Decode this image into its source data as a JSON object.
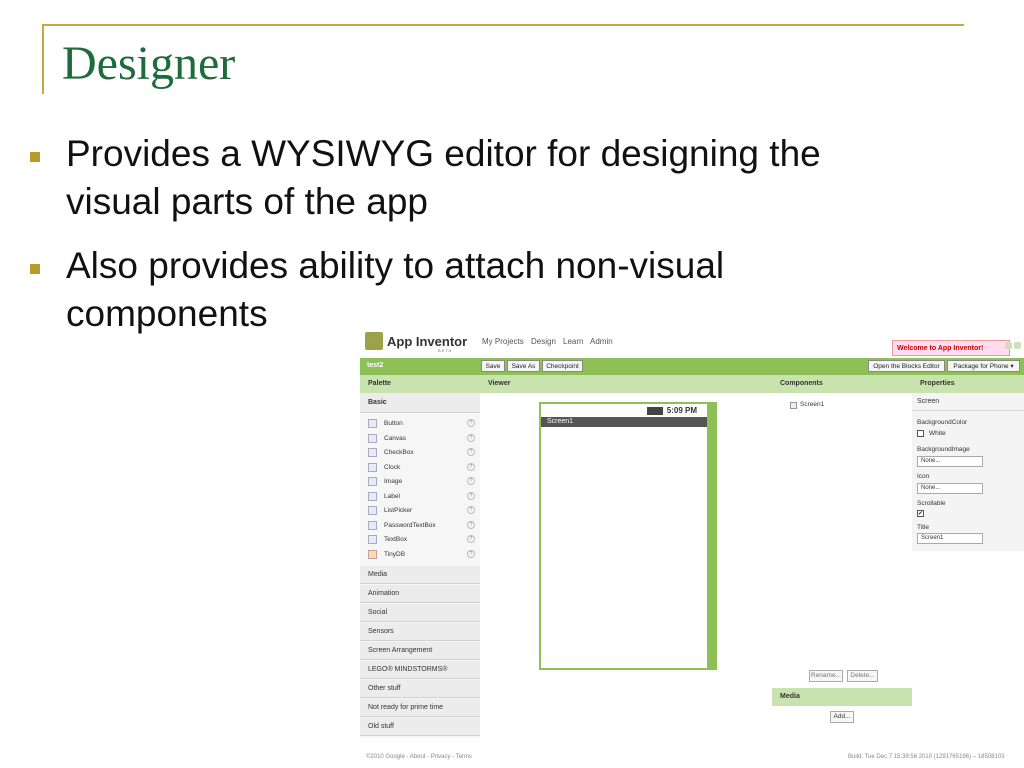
{
  "slide": {
    "title": "Designer",
    "bullets": [
      {
        "line1": "Provides a WYSIWYG editor for designing the",
        "line2": "visual parts of the app"
      },
      {
        "line1": "Also provides ability to attach non-visual",
        "line2": "components"
      }
    ]
  },
  "app": {
    "logo_text": "App Inventor",
    "logo_beta": "BETA",
    "nav": [
      "My Projects",
      "Design",
      "Learn",
      "Admin"
    ],
    "welcome": "Welcome to App Inventor!",
    "project_name": "test2",
    "toolbar": {
      "save": "Save",
      "save_as": "Save As",
      "checkpoint": "Checkpoint",
      "blocks_editor": "Open the Blocks Editor",
      "package": "Package for Phone ▾"
    },
    "columns": {
      "palette": "Palette",
      "viewer": "Viewer",
      "components": "Components",
      "properties": "Properties"
    },
    "palette": {
      "basic": "Basic",
      "items": [
        "Button",
        "Canvas",
        "CheckBox",
        "Clock",
        "Image",
        "Label",
        "ListPicker",
        "PasswordTextBox",
        "TextBox",
        "TinyDB"
      ],
      "help": "?",
      "categories": [
        "Media",
        "Animation",
        "Social",
        "Sensors",
        "Screen Arrangement",
        "LEGO® MINDSTORMS®",
        "Other stuff",
        "Not ready for prime time",
        "Old stuff"
      ]
    },
    "phone": {
      "time": "5:09 PM",
      "screen_title": "Screen1"
    },
    "components": {
      "tree_root": "Screen1",
      "rename": "Rename...",
      "delete": "Delete...",
      "media_header": "Media",
      "add": "Add..."
    },
    "properties": {
      "target": "Screen",
      "bg_color_label": "BackgroundColor",
      "bg_color_value": "White",
      "bg_image_label": "BackgroundImage",
      "bg_image_value": "None...",
      "icon_label": "Icon",
      "icon_value": "None...",
      "scrollable_label": "Scrollable",
      "scrollable_mark": "✔",
      "title_label": "Title",
      "title_value": "Screen1"
    },
    "footer": {
      "copyright": "©2010 Google - About - Privacy - Terms",
      "build": "Build: Tue Dec 7 15:39:56 2010 (1291765196) – 18508103"
    }
  },
  "colors": {
    "title_green": "#1e6b3c",
    "accent_gold": "#c8a640",
    "app_green": "#8dc056",
    "header_light_green": "#c9e3ae"
  }
}
